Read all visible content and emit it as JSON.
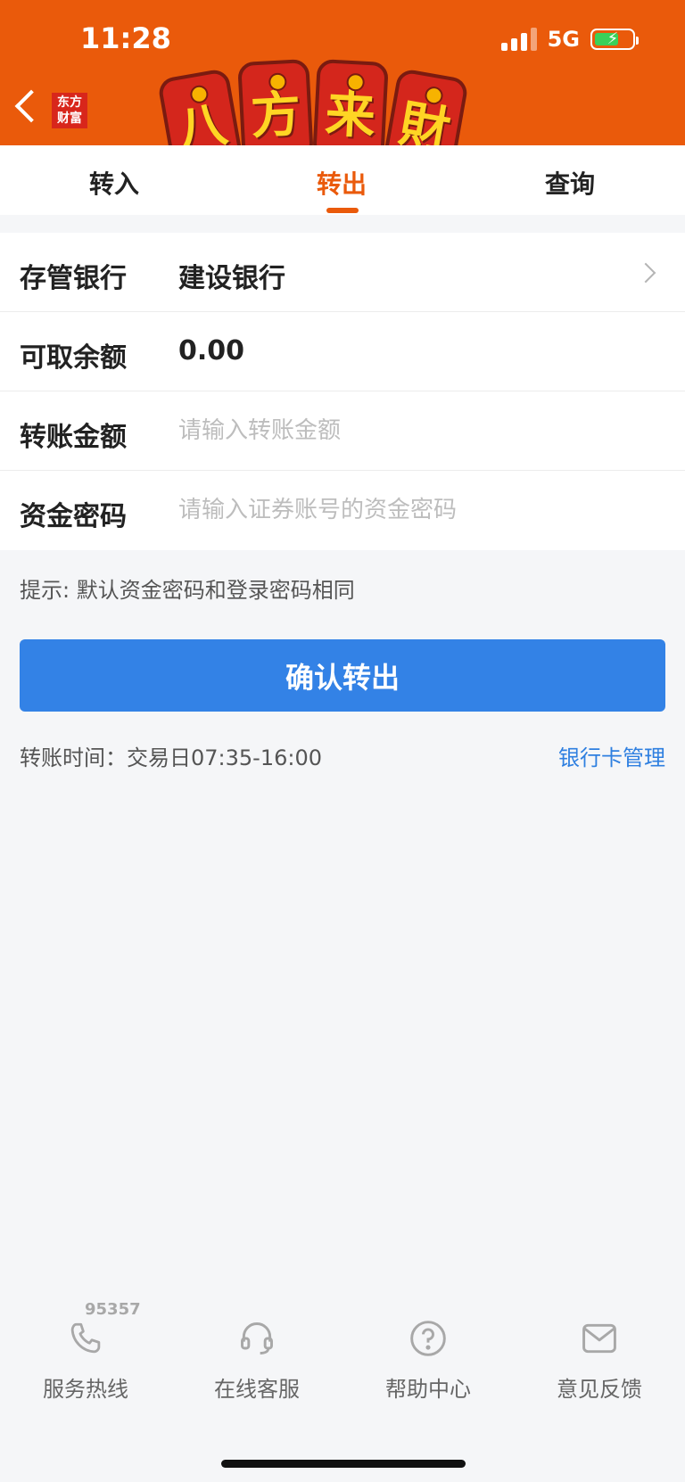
{
  "status": {
    "time": "11:28",
    "network": "5G"
  },
  "header": {
    "brand_logo_lines": [
      "东方",
      "财富"
    ],
    "banner_chars": [
      "八",
      "方",
      "来",
      "財"
    ]
  },
  "tabs": [
    {
      "label": "转入"
    },
    {
      "label": "转出",
      "active": true
    },
    {
      "label": "查询"
    }
  ],
  "form": {
    "bank": {
      "label": "存管银行",
      "value": "建设银行"
    },
    "balance": {
      "label": "可取余额",
      "value": "0.00"
    },
    "amount": {
      "label": "转账金额",
      "placeholder": "请输入转账金额"
    },
    "password": {
      "label": "资金密码",
      "placeholder": "请输入证券账号的资金密码"
    }
  },
  "tip": "提示: 默认资金密码和登录密码相同",
  "confirm_button": "确认转出",
  "transfer_time": "转账时间：交易日07:35-16:00",
  "card_manage": "银行卡管理",
  "bottom_bar": {
    "hotline_number": "95357",
    "items": [
      {
        "label": "服务热线",
        "icon": "phone-icon"
      },
      {
        "label": "在线客服",
        "icon": "headset-icon"
      },
      {
        "label": "帮助中心",
        "icon": "help-icon"
      },
      {
        "label": "意见反馈",
        "icon": "mail-icon"
      }
    ]
  },
  "colors": {
    "brand": "#ea5a0b",
    "primary": "#3382e6",
    "link": "#2e7fe0"
  }
}
